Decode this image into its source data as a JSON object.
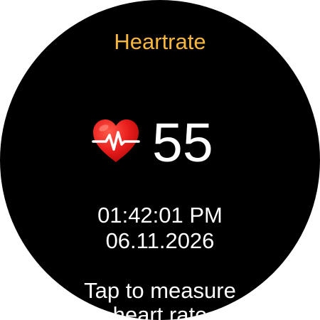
{
  "screen": {
    "title": "Heartrate",
    "title_color": "#f6b73c",
    "background_color": "#000000"
  },
  "reading": {
    "icon": "heart-pulse-icon",
    "bpm": "55"
  },
  "timestamp": {
    "time": "01:42:01 PM",
    "date": "06.11.2026"
  },
  "action": {
    "label": "Tap to measure\nheart rate"
  }
}
